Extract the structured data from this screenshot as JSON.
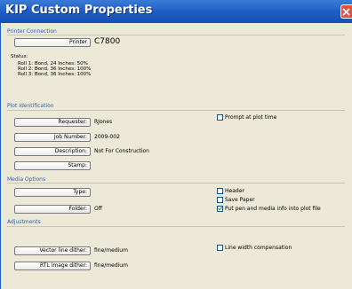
{
  "window": {
    "title": "KIP Custom Properties"
  },
  "printer_connection": {
    "section_label": "Printer Connection",
    "printer_button": "Printer",
    "printer_value": "C7800",
    "status_label": "Status:",
    "status_lines": [
      "Roll 1: Bond, 24 Inches: 50%",
      "Roll 2: Bond, 36 Inches: 100%",
      "Roll 3: Bond, 36 Inches: 100%"
    ]
  },
  "plot_identification": {
    "section_label": "Plot Identification",
    "requester_button": "Requester:",
    "requester_value": "RJones",
    "job_number_button": "Job Number:",
    "job_number_value": "2009-002",
    "description_button": "Description:",
    "description_value": "Not For Construction",
    "stamp_button": "Stamp:",
    "prompt_checkbox": {
      "label": "Prompt at plot time",
      "checked": false
    }
  },
  "media_options": {
    "section_label": "Media Options",
    "type_button": "Type:",
    "folder_button": "Folder:",
    "folder_value": "Off",
    "header_checkbox": {
      "label": "Header",
      "checked": false
    },
    "save_paper_checkbox": {
      "label": "Save Paper",
      "checked": false
    },
    "pen_info_checkbox": {
      "label": "Put pen and media info into plot file",
      "checked": true
    }
  },
  "adjustments": {
    "section_label": "Adjustments",
    "vector_button": "Vector line dither:",
    "vector_value": "fine/medium",
    "rtl_button": "RTL image dither:",
    "rtl_value": "fine/medium",
    "line_width_checkbox": {
      "label": "Line width compensation",
      "checked": false
    }
  }
}
